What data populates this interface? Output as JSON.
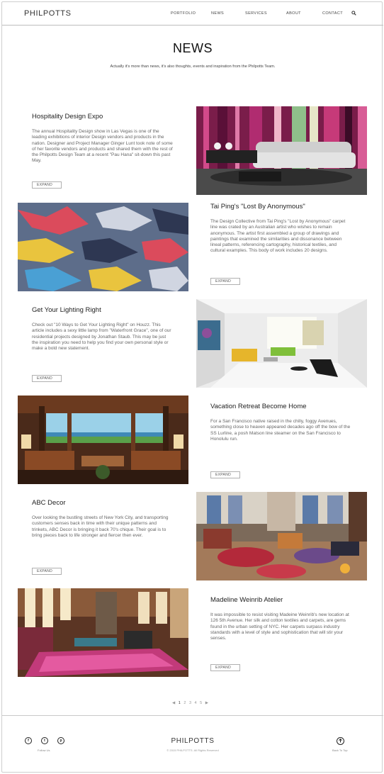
{
  "header": {
    "logo": "PHILPOTTS",
    "nav": [
      "PORTFOLIO",
      "NEWS",
      "SERVICES",
      "ABOUT",
      "CONTACT"
    ],
    "search_icon": "search-icon"
  },
  "page": {
    "title": "NEWS",
    "subtitle": "Actually it's more than news, it's also thoughts, events and inspiration from the Philpotts Team."
  },
  "expand_label": "EXPAND",
  "articles": [
    {
      "title": "Hospitality Design Expo",
      "body": "The annual Hospitality Design show in Las Vegas is one of the leading exhibitions of interior Design vendors and products in the nation. Designer and Project Manager Ginger Lunt took note of some of her favorite vendors and products and shared them with the rest of the Philpotts Design Team at a recent \"Pau Hana\" sit-down this past May.",
      "image": "white sofa in front of pink striped wall"
    },
    {
      "title": "Tai Ping's \"Lost By Anonymous\"",
      "body": "The Design Collective from Tai Ping's \"Lost by Anonymous\" carpet line was crated by an Australian artist who wishes to remain anonymous. The artist first assembled a group of drawings and paintings that examined the similarities and dissonance between lineal patterns, referencing cartography, historical textiles, and cultural examples. This body of work includes 20 designs.",
      "image": "patterned carpet"
    },
    {
      "title": "Get Your Lighting Right",
      "body": "Check out \"10 Ways to Get Your Lighting Right\" on Houzz. This article includes a sexy little lamp from \"Waterfront Grace\", one of our residential projects designed by Jonathan Staub. This may be just the inspiration you need to help you find your own personal style or make a bold new statement.",
      "image": "bright white living room"
    },
    {
      "title": "Vacation Retreat Become Home",
      "body": "For a San Francisco native raised in the chilly, foggy Avenues, something close to heaven appeared decades ago off the bow of the SS Lurline, a posh Matson line steamer on the San Francisco to Honolulu run.",
      "image": "open-air lanai at sunset"
    },
    {
      "title": "ABC Decor",
      "body": "Over looking the bustling streets of New York City, and transporting customers senses back in time with their unique patterns and trinkets, ABC Decor is bringing it back 70's chique. Their goal is to bring pieces back to life stronger and fiercer then ever.",
      "image": "colorful showroom with patterned furniture"
    },
    {
      "title": "Madeline Weinrib Atelier",
      "body": "It was impossible to resist visiting Madeine Weinrib's new location at 126 5th Avenue. Her silk and cotton textiles and carpets, are gems found in the urban setting of NYC. Her carpets surpass industry standards with a level of style and sophistication that will stir your senses.",
      "image": "loft showroom with stacked rugs"
    }
  ],
  "pagination": {
    "prev": "◀",
    "pages": [
      "1",
      "2",
      "3",
      "4",
      "5"
    ],
    "current": "1",
    "next": "▶"
  },
  "footer": {
    "social_icons": [
      "facebook-icon",
      "twitter-icon",
      "pinterest-icon"
    ],
    "follow": "Follow Us",
    "logo": "PHILPOTTS",
    "copyright": "© 2015 PHILPOTTS. All Rights Reserved",
    "back_to_top": "Back To Top"
  },
  "colors": {
    "text": "#222222",
    "muted": "#666666",
    "rule": "#c9c9c9"
  }
}
